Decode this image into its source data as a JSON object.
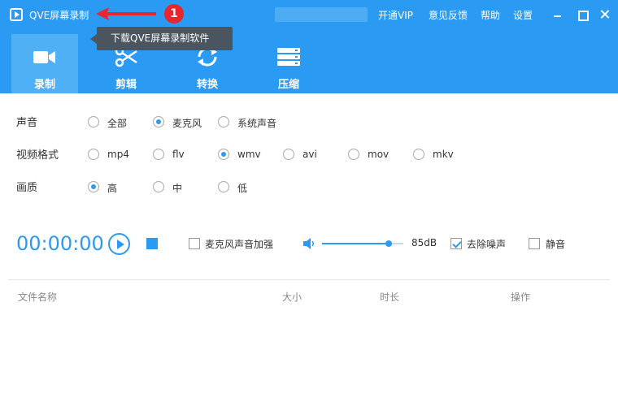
{
  "titlebar": {
    "app_title": "QVE屏幕录制",
    "links": [
      "开通VIP",
      "意见反馈",
      "帮助",
      "设置"
    ]
  },
  "annotation": {
    "badge": "1",
    "tooltip": "下载QVE屏幕录制软件"
  },
  "tabs": [
    {
      "label": "录制",
      "icon": "video-camera-icon",
      "active": true
    },
    {
      "label": "剪辑",
      "icon": "scissors-icon",
      "active": false
    },
    {
      "label": "转换",
      "icon": "refresh-icon",
      "active": false
    },
    {
      "label": "压缩",
      "icon": "compress-icon",
      "active": false
    }
  ],
  "options": {
    "sound": {
      "label": "声音",
      "choices": [
        "全部",
        "麦克风",
        "系统声音"
      ],
      "selected": "麦克风"
    },
    "format": {
      "label": "视频格式",
      "choices": [
        "mp4",
        "flv",
        "wmv",
        "avi",
        "mov",
        "mkv"
      ],
      "selected": "wmv"
    },
    "quality": {
      "label": "画质",
      "choices": [
        "高",
        "中",
        "低"
      ],
      "selected": "高"
    }
  },
  "controls": {
    "timer": "00:00:00",
    "mic_boost_label": "麦克风声音加强",
    "mic_boost_checked": false,
    "volume_db": "85dB",
    "volume_level": 0.82,
    "denoise_label": "去除噪声",
    "denoise_checked": true,
    "mute_label": "静音",
    "mute_checked": false
  },
  "table": {
    "columns": [
      "文件名称",
      "大小",
      "时长",
      "操作"
    ]
  },
  "colors": {
    "accent": "#2b9af3",
    "tab_active": "#4fb0f6",
    "badge": "#e8262d",
    "tooltip_bg": "#4a5560"
  }
}
